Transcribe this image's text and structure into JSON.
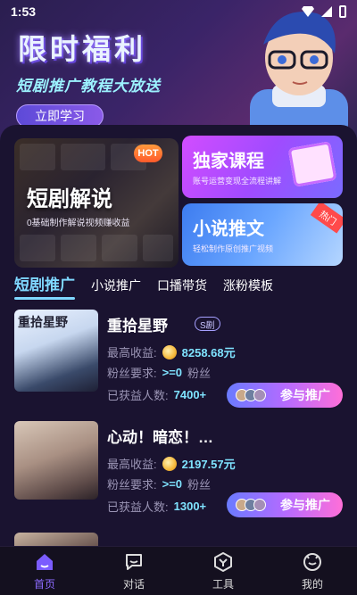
{
  "status": {
    "time": "1:53"
  },
  "hero": {
    "title": "限时福利",
    "subtitle": "短剧推广教程大放送",
    "cta": "立即学习"
  },
  "cards": {
    "big": {
      "label": "短剧解说",
      "desc": "0基础制作解说视频赚收益",
      "badge": "HOT"
    },
    "right1": {
      "label": "独家课程",
      "desc": "账号运营变现全流程讲解"
    },
    "right2": {
      "label": "小说推文",
      "desc": "轻松制作原创推广视频",
      "ribbon": "热门"
    }
  },
  "tabs": [
    "短剧推广",
    "小说推广",
    "口播带货",
    "涨粉模板"
  ],
  "items": [
    {
      "poster_text": "重拾星野",
      "title": "重拾星野",
      "badge": "S剧",
      "max_income_label": "最高收益:",
      "max_income": "8258.68元",
      "fans_label": "粉丝要求:",
      "fans_value": ">=0",
      "fans_unit": "粉丝",
      "earned_label": "已获益人数:",
      "earned_value": "7400+",
      "button": "参与推广"
    },
    {
      "poster_text": "",
      "title": "心动！暗恋！…",
      "badge": "",
      "max_income_label": "最高收益:",
      "max_income": "2197.57元",
      "fans_label": "粉丝要求:",
      "fans_value": ">=0",
      "fans_unit": "粉丝",
      "earned_label": "已获益人数:",
      "earned_value": "1300+",
      "button": "参与推广"
    }
  ],
  "nav": [
    "首页",
    "对话",
    "工具",
    "我的"
  ],
  "colors": {
    "accent": "#7fd8ff",
    "purple": "#8d6bff",
    "bg": "#151028"
  }
}
